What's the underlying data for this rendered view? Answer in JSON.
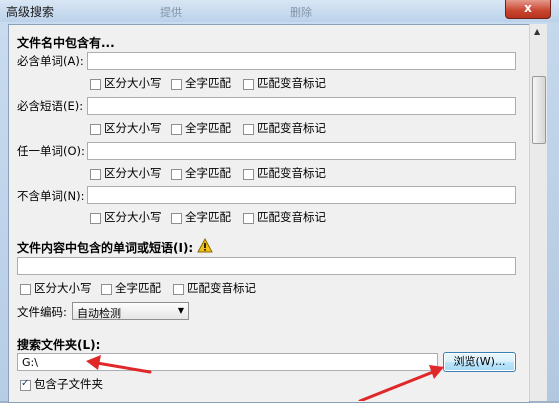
{
  "window": {
    "title": "高级搜索",
    "blurred_title_1": "提供",
    "blurred_title_2": "删除",
    "close_symbol": "x"
  },
  "filename_section": {
    "heading": "文件名中包含有...",
    "fields": [
      {
        "label": "必含单词(A):",
        "value": ""
      },
      {
        "label": "必含短语(E):",
        "value": ""
      },
      {
        "label": "任一单词(O):",
        "value": ""
      },
      {
        "label": "不含单词(N):",
        "value": ""
      }
    ],
    "options": [
      "区分大小写",
      "全字匹配",
      "匹配变音标记"
    ]
  },
  "content_section": {
    "heading": "文件内容中包含的单词或短语(I):",
    "value": "",
    "options": [
      "区分大小写",
      "全字匹配",
      "匹配变音标记"
    ],
    "encoding_label": "文件编码:",
    "encoding_value": "自动检测"
  },
  "folder_section": {
    "heading": "搜索文件夹(L):",
    "path_value": "G:\\",
    "browse_label": "浏览(W)...",
    "include_subfolders_label": "包含子文件夹",
    "include_subfolders_checked": true
  },
  "annotations": {
    "arrow_color": "#e0282a"
  }
}
